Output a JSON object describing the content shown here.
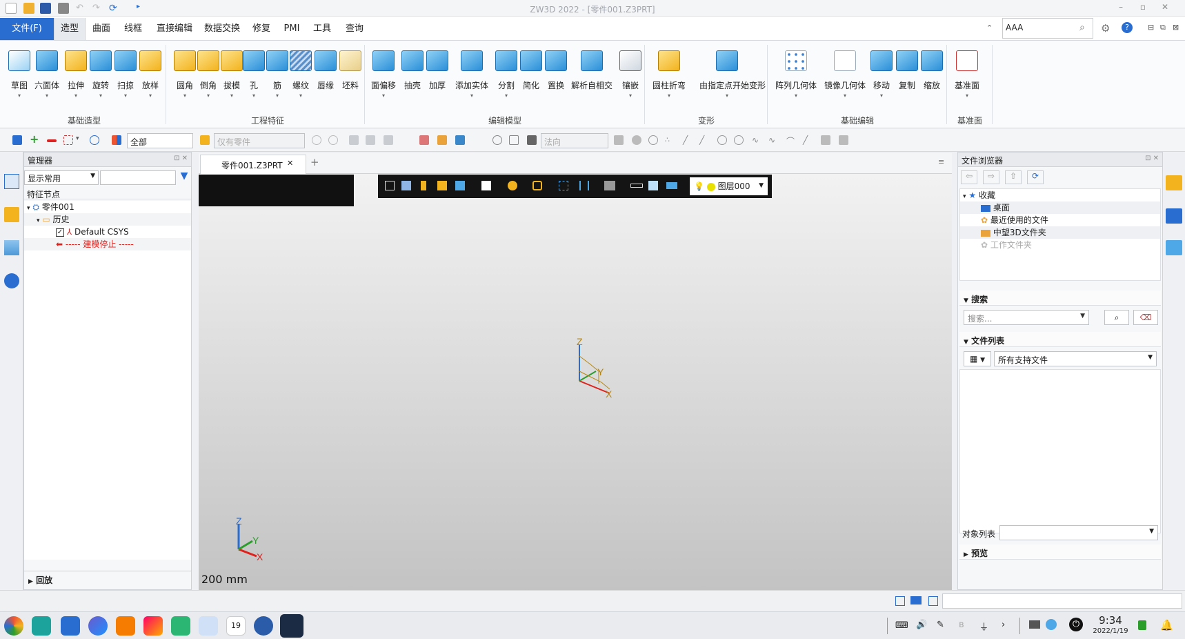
{
  "window": {
    "title": "ZW3D 2022 - [零件001.Z3PRT]"
  },
  "menu": {
    "file_label": "文件(F)",
    "tabs": [
      "造型",
      "曲面",
      "线框",
      "直接编辑",
      "数据交换",
      "修复",
      "PMI",
      "工具",
      "查询"
    ],
    "search_value": "AAA"
  },
  "ribbon": {
    "groups": [
      {
        "label": "基础造型",
        "buttons": [
          "草图",
          "六面体",
          "拉伸",
          "旋转",
          "扫掠",
          "放样"
        ]
      },
      {
        "label": "工程特征",
        "buttons": [
          "圆角",
          "倒角",
          "拔模",
          "孔",
          "筋",
          "螺纹",
          "唇缘",
          "坯料"
        ]
      },
      {
        "label": "编辑模型",
        "buttons": [
          "面偏移",
          "抽壳",
          "加厚",
          "添加实体",
          "分割",
          "简化",
          "置换",
          "解析自相交",
          "镶嵌"
        ]
      },
      {
        "label": "变形",
        "buttons": [
          "圆柱折弯",
          "由指定点开始变形"
        ]
      },
      {
        "label": "基础编辑",
        "buttons": [
          "阵列几何体",
          "镜像几何体",
          "移动",
          "复制",
          "缩放"
        ]
      },
      {
        "label": "基准面",
        "buttons": [
          "基准面"
        ]
      }
    ]
  },
  "toolbar": {
    "filter_value": "全部",
    "part_filter_placeholder": "仅有零件",
    "direction_placeholder": "法向"
  },
  "manager": {
    "title": "管理器",
    "display_value": "显示常用",
    "tree_header": "特征节点",
    "tree": {
      "part": "零件001",
      "history": "历史",
      "csys": "Default CSYS",
      "stop": "----- 建模停止 -----"
    },
    "replay_label": "回放"
  },
  "viewport": {
    "tab_label": "零件001.Z3PRT",
    "layer_label": "图层000",
    "scale_label": "200 mm",
    "axes": {
      "x": "X",
      "y": "Y",
      "z": "Z"
    }
  },
  "file_browser": {
    "title": "文件浏览器",
    "favorites_label": "收藏",
    "items": [
      "桌面",
      "最近使用的文件",
      "中望3D文件夹",
      "工作文件夹"
    ],
    "search_section": "搜索",
    "search_placeholder": "搜索...",
    "file_list_section": "文件列表",
    "file_type_value": "所有支持文件",
    "object_list_label": "对象列表",
    "preview_section": "预览"
  },
  "taskbar": {
    "time": "9:34",
    "date": "2022/1/19",
    "calendar_day": "19"
  },
  "colors": {
    "accent": "#2a6dd0",
    "stop_red": "#e0201b",
    "toolbar_dark": "#111111"
  }
}
